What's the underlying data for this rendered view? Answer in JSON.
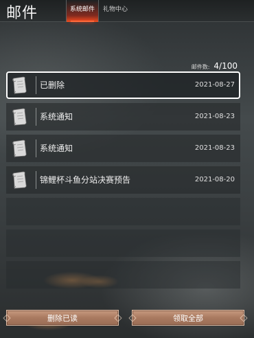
{
  "header": {
    "title": "邮件",
    "tabs": [
      {
        "label": "系统邮件",
        "active": true
      },
      {
        "label": "礼物中心",
        "active": false
      }
    ]
  },
  "mail_count": {
    "label": "邮件数:",
    "value": "4/100"
  },
  "mails": [
    {
      "subject": "已删除",
      "date": "2021-08-27",
      "selected": true,
      "icon": "scroll-icon"
    },
    {
      "subject": "系统通知",
      "date": "2021-08-23",
      "selected": false,
      "icon": "scroll-icon"
    },
    {
      "subject": "系统通知",
      "date": "2021-08-23",
      "selected": false,
      "icon": "scroll-icon"
    },
    {
      "subject": "锦鲤杯斗鱼分站决赛预告",
      "date": "2021-08-20",
      "selected": false,
      "icon": "scroll-icon"
    }
  ],
  "empty_slots": 3,
  "buttons": {
    "delete_read": "删除已读",
    "claim_all": "领取全部"
  },
  "colors": {
    "accent_tab": "#ff6a3a",
    "button_fill": "#a97a60",
    "selected_border": "#ffffff"
  }
}
